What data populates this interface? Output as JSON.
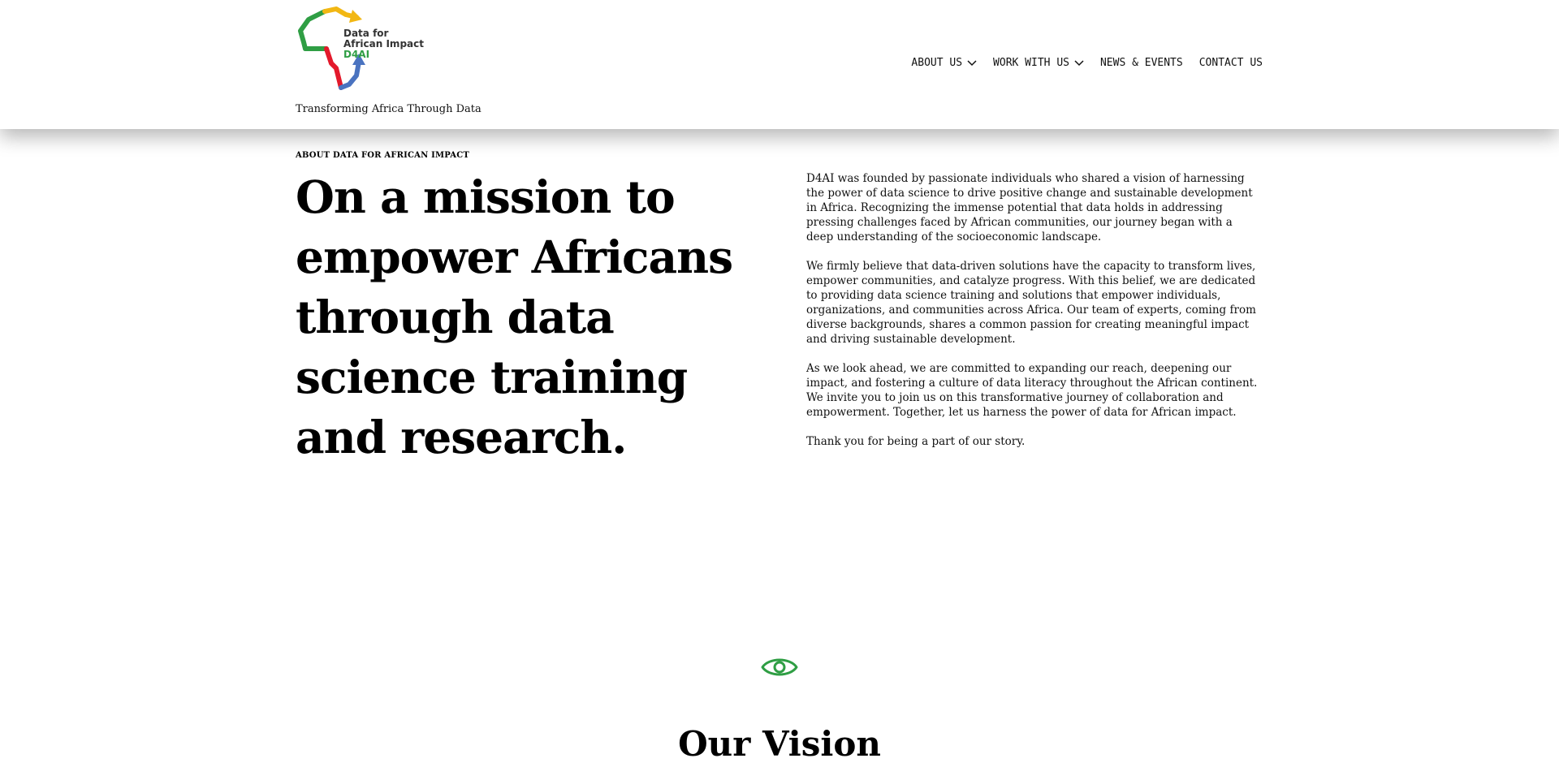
{
  "header": {
    "logo": {
      "name": "Data for African Impact logo",
      "line1": "Data for",
      "line2": "African Impact",
      "abbr": "D4AI",
      "tagline": "Transforming Africa Through Data",
      "colors": {
        "green": "#2f9e44",
        "yellow": "#f2b713",
        "red": "#e3192b",
        "blue": "#4a73c0"
      }
    },
    "nav": [
      {
        "label": "ABOUT US",
        "has_dropdown": true
      },
      {
        "label": "WORK WITH US",
        "has_dropdown": true
      },
      {
        "label": "NEWS & EVENTS",
        "has_dropdown": false
      },
      {
        "label": "CONTACT US",
        "has_dropdown": false
      }
    ]
  },
  "about": {
    "eyebrow": "ABOUT DATA FOR AFRICAN IMPACT",
    "headline": "On a mission to empower Africans through data science training and research.",
    "paragraphs": [
      "D4AI was founded by passionate individuals who shared a vision of harnessing the power of data science to drive positive change and sustainable development in Africa. Recognizing the immense potential that data holds in addressing pressing challenges faced by African communities, our journey began with a deep understanding of the socioeconomic landscape.",
      "We firmly believe that data-driven solutions have the capacity to transform lives, empower communities, and catalyze progress. With this belief, we are dedicated to providing data science training and solutions that empower individuals, organizations, and communities across Africa. Our team of experts, coming from diverse backgrounds, shares a common passion for creating meaningful impact and driving sustainable development.",
      "As we look ahead, we are committed to expanding our reach, deepening our impact, and fostering a culture of data literacy throughout the African continent. We invite you to join us on this transformative journey of collaboration and empowerment. Together, let us harness the power of data for African impact.",
      "Thank you for being a part of our story."
    ]
  },
  "vision": {
    "icon": "eye-icon",
    "icon_color": "#2f9e44",
    "title": "Our Vision"
  }
}
